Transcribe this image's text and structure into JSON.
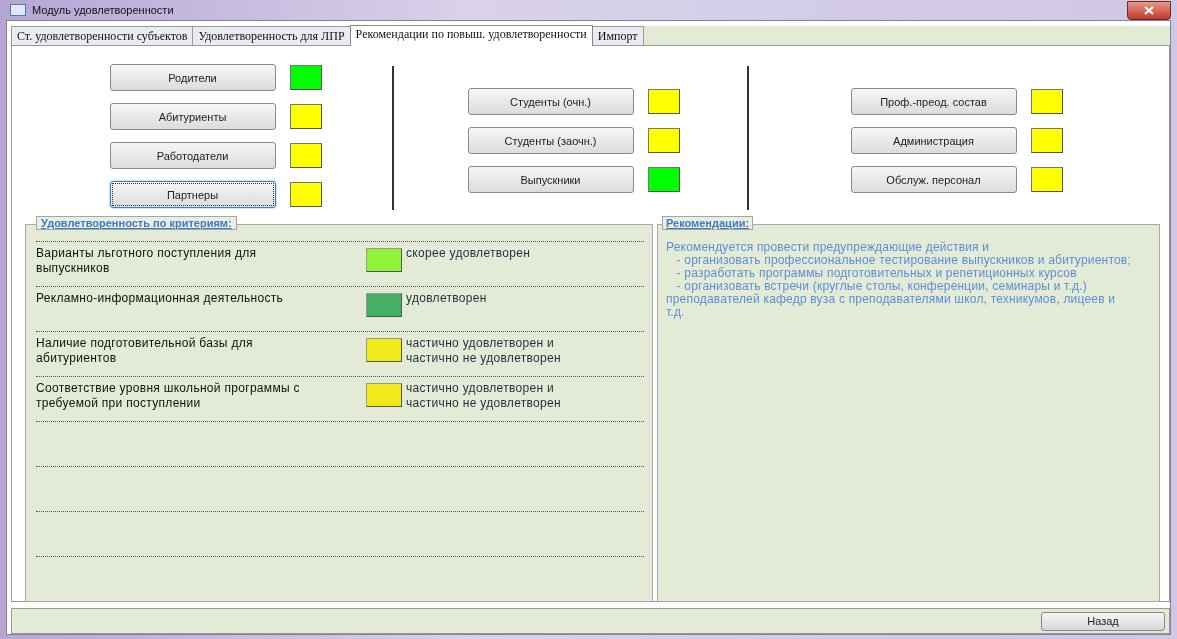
{
  "window": {
    "title": "Модуль удовлетворенности"
  },
  "tabs": [
    {
      "label": "Ст. удовлетворенности субъектов",
      "selected": false
    },
    {
      "label": "Удовлетворенность для ЛПР",
      "selected": false
    },
    {
      "label": "Рекомендации по повыш. удовлетворенности",
      "selected": true
    },
    {
      "label": "Импорт",
      "selected": false
    }
  ],
  "groups": [
    {
      "subjects": [
        {
          "label": "Родители",
          "color": "#00ff00",
          "focused": false
        },
        {
          "label": "Абитуриенты",
          "color": "#ffff00",
          "focused": false
        },
        {
          "label": "Работодатели",
          "color": "#ffff00",
          "focused": false
        },
        {
          "label": "Партнеры",
          "color": "#ffff00",
          "focused": true
        }
      ]
    },
    {
      "subjects": [
        {
          "label": "Студенты (очн.)",
          "color": "#ffff00",
          "focused": false
        },
        {
          "label": "Студенты (заочн.)",
          "color": "#ffff00",
          "focused": false
        },
        {
          "label": "Выпускники",
          "color": "#00ff00",
          "focused": false
        }
      ]
    },
    {
      "subjects": [
        {
          "label": "Проф.-преод. состав",
          "color": "#ffff00",
          "focused": false
        },
        {
          "label": "Администрация",
          "color": "#ffff00",
          "focused": false
        },
        {
          "label": "Обслуж. персонал",
          "color": "#ffff00",
          "focused": false
        }
      ]
    }
  ],
  "criteria": {
    "title": "Удовлетворенность по критериям:",
    "rows": [
      {
        "criterion": "Варианты льготного поступления для выпускников",
        "color": "#92f23a",
        "status": "скорее удовлетворен"
      },
      {
        "criterion": "Рекламно-информационная деятельность",
        "color": "#45b065",
        "status": "удовлетворен"
      },
      {
        "criterion": "Наличие подготовительной базы для абитуриентов",
        "color": "#f2ea18",
        "status": "частично удовлетворен и частично не удовлетворен"
      },
      {
        "criterion": "Соответствие уровня школьной программы с требуемой при поступлении",
        "color": "#f2ea18",
        "status": "частично удовлетворен и частично не удовлетворен"
      }
    ]
  },
  "recommendations": {
    "title": "Рекомендации:",
    "text": "Рекомендуется провести предупреждающие действия и\n   - организовать профессиональное тестирование выпускников и абитуриентов;\n   - разработать программы подготовительных и репетиционных курсов\n   - организовать встречи (круглые столы, конференции, семинары и т.д.) преподавателей кафедр вуза с преподавателями школ, техникумов, лицеев и т.д."
  },
  "back_button": "Назад"
}
